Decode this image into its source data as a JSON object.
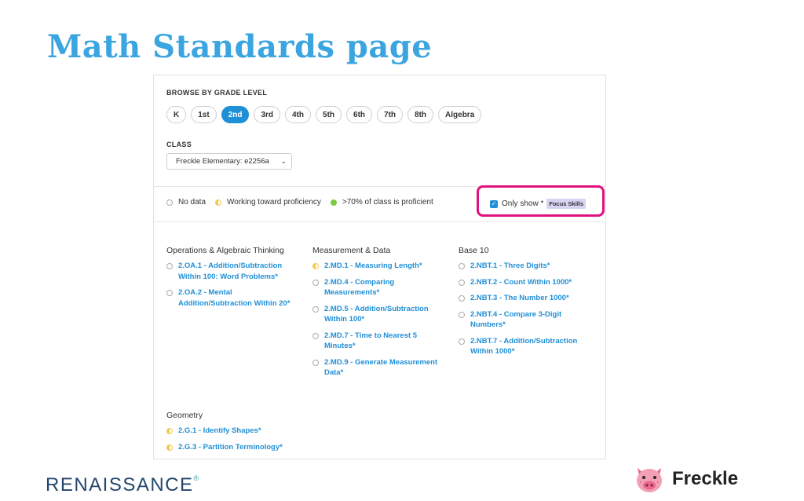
{
  "slide_title": "Math Standards page",
  "browse": {
    "label": "BROWSE BY GRADE LEVEL",
    "grades": [
      "K",
      "1st",
      "2nd",
      "3rd",
      "4th",
      "5th",
      "6th",
      "7th",
      "8th",
      "Algebra"
    ],
    "selected": "2nd"
  },
  "class": {
    "label": "CLASS",
    "selected": "Freckle Elementary: e2256a"
  },
  "legend": {
    "no_data": "No data",
    "working": "Working toward proficiency",
    "proficient": ">70% of class is proficient"
  },
  "filter": {
    "only_show": "Only show *",
    "focus_tag": "Focus Skills",
    "checked": true
  },
  "columns": [
    {
      "title": "Operations & Algebraic Thinking",
      "standards": [
        {
          "text": "2.OA.1 - Addition/Subtraction Within 100: Word Problems*",
          "status": "none"
        },
        {
          "text": "2.OA.2 - Mental Addition/Subtraction Within 20*",
          "status": "none"
        }
      ]
    },
    {
      "title": "Measurement & Data",
      "standards": [
        {
          "text": "2.MD.1 - Measuring Length*",
          "status": "half"
        },
        {
          "text": "2.MD.4 - Comparing Measurements*",
          "status": "none"
        },
        {
          "text": "2.MD.5 - Addition/Subtraction Within 100*",
          "status": "none"
        },
        {
          "text": "2.MD.7 - Time to Nearest 5 Minutes*",
          "status": "none"
        },
        {
          "text": "2.MD.9 - Generate Measurement Data*",
          "status": "none"
        }
      ]
    },
    {
      "title": "Base 10",
      "standards": [
        {
          "text": "2.NBT.1 - Three Digits*",
          "status": "none"
        },
        {
          "text": "2.NBT.2 - Count Within 1000*",
          "status": "none"
        },
        {
          "text": "2.NBT.3 - The Number 1000*",
          "status": "none"
        },
        {
          "text": "2.NBT.4 - Compare 3-Digit Numbers*",
          "status": "none"
        },
        {
          "text": "2.NBT.7 - Addition/Subtraction Within 1000*",
          "status": "none"
        }
      ]
    },
    {
      "title": "Geometry",
      "standards": [
        {
          "text": "2.G.1 - Identify Shapes*",
          "status": "half"
        },
        {
          "text": "2.G.3 - Partition Terminology*",
          "status": "half"
        }
      ]
    }
  ],
  "footer": {
    "renaissance": "RENAISSANCE",
    "trademark": "®",
    "freckle": "Freckle"
  },
  "colors": {
    "title": "#3aa5e0",
    "accent": "#1f8fd6",
    "highlight_border": "#e0117c",
    "proficient": "#7ac943",
    "working": "#f2c94c"
  }
}
